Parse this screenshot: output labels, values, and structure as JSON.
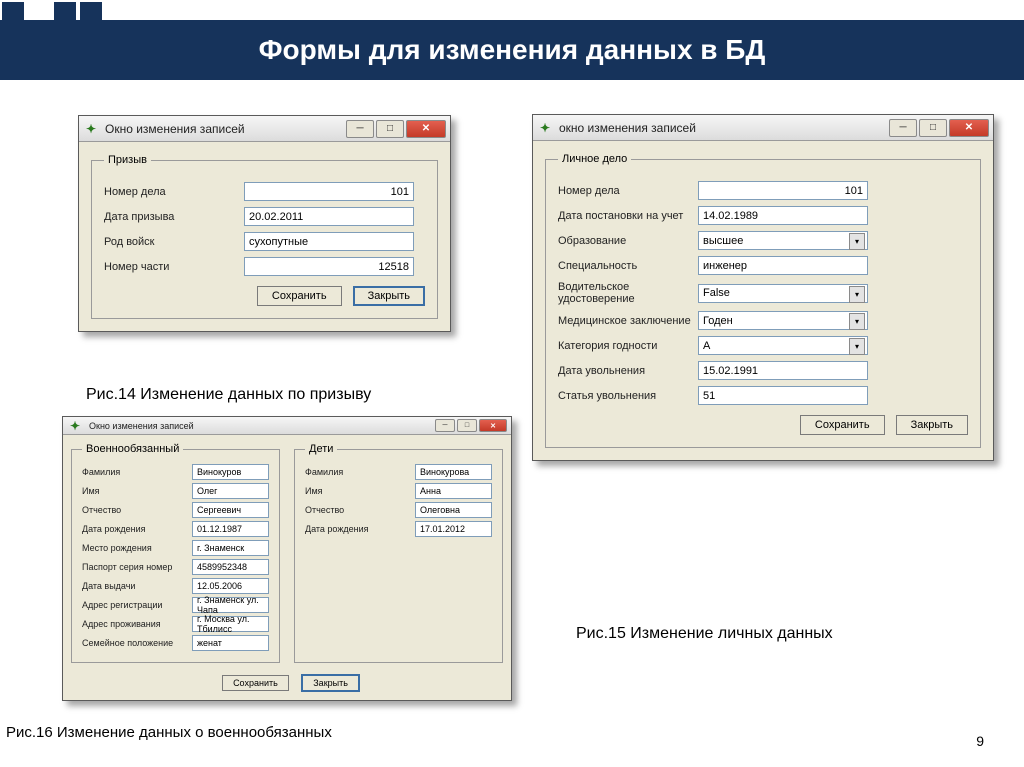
{
  "slide": {
    "title": "Формы для изменения данных в БД",
    "page_number": "9"
  },
  "captions": {
    "fig14": "Рис.14 Изменение  данных по призыву",
    "fig15": "Рис.15 Изменение личных данных",
    "fig16": "Рис.16 Изменение  данных о военнообязанных"
  },
  "window1": {
    "title": "Окно изменения записей",
    "group": "Призыв",
    "fields": {
      "case_no_label": "Номер дела",
      "case_no": "101",
      "draft_date_label": "Дата призыва",
      "draft_date": "20.02.2011",
      "branch_label": "Род войск",
      "branch": "сухопутные",
      "unit_label": "Номер части",
      "unit": "12518"
    },
    "buttons": {
      "save": "Сохранить",
      "close": "Закрыть"
    }
  },
  "window2": {
    "title": "окно изменения записей",
    "group": "Личное дело",
    "fields": {
      "case_no_label": "Номер дела",
      "case_no": "101",
      "reg_date_label": "Дата постановки на учет",
      "reg_date": "14.02.1989",
      "edu_label": "Образование",
      "edu": "высшее",
      "spec_label": "Специальность",
      "spec": "инженер",
      "license_label": "Водительское удостоверение",
      "license": "False",
      "med_label": "Медицинское заключение",
      "med": "Годен",
      "cat_label": "Категория годности",
      "cat": "А",
      "dis_date_label": "Дата увольнения",
      "dis_date": "15.02.1991",
      "dis_art_label": "Статья увольнения",
      "dis_art": "51"
    },
    "buttons": {
      "save": "Сохранить",
      "close": "Закрыть"
    }
  },
  "window3": {
    "title": "Окно изменения записей",
    "group_a": "Военнообязанный",
    "group_b": "Дети",
    "person": {
      "surname_label": "Фамилия",
      "surname": "Винокуров",
      "name_label": "Имя",
      "name": "Олег",
      "patr_label": "Отчество",
      "patr": "Сергеевич",
      "dob_label": "Дата рождения",
      "dob": "01.12.1987",
      "pob_label": "Место рождения",
      "pob": "г. Знаменск",
      "pass_label": "Паспорт серия номер",
      "pass": "4589952348",
      "idate_label": "Дата выдачи",
      "idate": "12.05.2006",
      "reg_label": "Адрес регистрации",
      "reg": "г. Знаменск ул. Чапа",
      "res_label": "Адрес проживания",
      "res": "г. Москва ул. Тбилисс",
      "mar_label": "Семейное положение",
      "mar": "женат"
    },
    "child": {
      "surname_label": "Фамилия",
      "surname": "Винокурова",
      "name_label": "Имя",
      "name": "Анна",
      "patr_label": "Отчество",
      "patr": "Олеговна",
      "dob_label": "Дата рождения",
      "dob": "17.01.2012"
    },
    "buttons": {
      "save": "Сохранить",
      "close": "Закрыть"
    }
  }
}
